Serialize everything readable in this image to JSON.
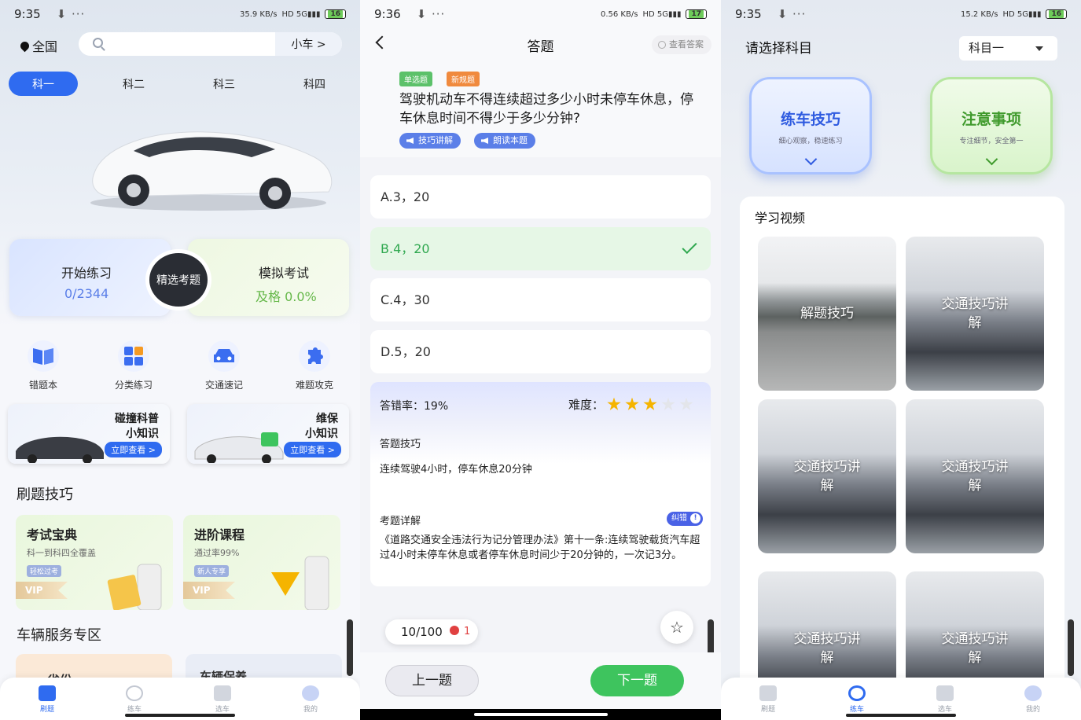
{
  "colors": {
    "primary": "#2f6bf0",
    "success": "#3ec45e",
    "danger": "#e04040",
    "star": "#f5b400"
  },
  "home": {
    "status": {
      "time": "9:35",
      "speed": "35.9 KB/s",
      "battery": "16"
    },
    "location": "全国",
    "search": {
      "placeholder": "",
      "car_type": "小车 >"
    },
    "subject_tabs": [
      "科一",
      "科二",
      "科三",
      "科四"
    ],
    "practice": {
      "title": "开始练习",
      "progress": "0/2344"
    },
    "featured": "精选考题",
    "mock": {
      "title": "模拟考试",
      "pass": "及格 0.0%"
    },
    "tools": [
      {
        "label": "错题本",
        "icon": "book-icon"
      },
      {
        "label": "分类练习",
        "icon": "category-icon"
      },
      {
        "label": "交通速记",
        "icon": "car-front-icon"
      },
      {
        "label": "难题攻克",
        "icon": "puzzle-icon"
      }
    ],
    "banners": [
      {
        "title": "碰撞科普",
        "title2": "小知识",
        "button": "立即查看 >"
      },
      {
        "title": "维保",
        "title2": "小知识",
        "button": "立即查看 >"
      }
    ],
    "tips_title": "刷题技巧",
    "courses": [
      {
        "title": "考试宝典",
        "subtitle": "科一到科四全覆盖",
        "tag": "轻松过考",
        "badge": "VIP"
      },
      {
        "title": "进阶课程",
        "subtitle": "通过率99%",
        "tag": "新人专享",
        "badge": "VIP"
      }
    ],
    "service_title": "车辆服务专区",
    "service_items": [
      "省份",
      "车辆保养"
    ],
    "nav": [
      "刷题",
      "练车",
      "选车",
      "我的"
    ]
  },
  "quiz": {
    "status": {
      "time": "9:36",
      "speed": "0.56 KB/s",
      "battery": "17"
    },
    "title": "答题",
    "peek": "查看答案",
    "tags": [
      "单选题",
      "新规题"
    ],
    "question": "驾驶机动车不得连续超过多少小时未停车休息，停车休息时间不得少于多少分钟?",
    "buttons": [
      "技巧讲解",
      "朗读本题"
    ],
    "options": [
      "A.3，20",
      "B.4，20",
      "C.4，30",
      "D.5，20"
    ],
    "correct_index": 1,
    "error_rate": "答错率：19%",
    "difficulty_label": "难度：",
    "difficulty": 3,
    "difficulty_max": 5,
    "tip_heading": "答题技巧",
    "tip_text": "连续驾驶4小时，停车休息20分钟",
    "detail_heading": "考题详解",
    "report": "纠错",
    "detail_text": "《道路交通安全违法行为记分管理办法》第十一条:连续驾驶载货汽车超过4小时未停车休息或者停车休息时间少于20分钟的，一次记3分。",
    "counter": "10/100",
    "wrong_count": "1",
    "prev": "上一题",
    "next": "下一题"
  },
  "practice_car": {
    "status": {
      "time": "9:35",
      "speed": "15.2 KB/s",
      "battery": "16"
    },
    "heading": "请选择科目",
    "subject": "科目一",
    "tiles": [
      {
        "title": "练车技巧",
        "subtitle": "细心观察，稳速练习"
      },
      {
        "title": "注意事项",
        "subtitle": "专注细节，安全第一"
      }
    ],
    "videos_title": "学习视频",
    "videos": [
      {
        "label": "解题技巧"
      },
      {
        "label": "交通技巧讲解"
      },
      {
        "label": "交通技巧讲解"
      },
      {
        "label": "交通技巧讲解"
      },
      {
        "label": "交通技巧讲解"
      },
      {
        "label": "交通技巧讲解"
      }
    ],
    "nav": [
      "刷题",
      "练车",
      "选车",
      "我的"
    ]
  }
}
